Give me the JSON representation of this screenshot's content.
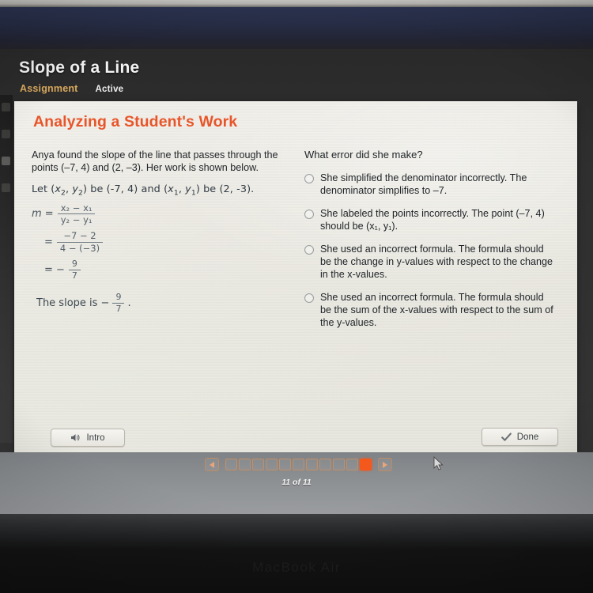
{
  "device": {
    "brand_label": "MacBook Air"
  },
  "header": {
    "lesson_title": "Slope of a Line",
    "assignment_label": "Assignment",
    "status_label": "Active"
  },
  "card": {
    "title": "Analyzing a Student's Work"
  },
  "work": {
    "prompt": "Anya found the slope of the line that passes through the points (–7, 4) and (2, –3). Her work is shown below.",
    "let_statement_parts": {
      "prefix": "Let (",
      "x2": "x",
      "x2sub": "2",
      "comma1": ", ",
      "y2": "y",
      "y2sub": "2",
      "mid": ") be (-7, 4) and (",
      "x1": "x",
      "x1sub": "1",
      "comma2": ", ",
      "y1": "y",
      "y1sub": "1",
      "suffix": ") be (2, -3)."
    },
    "equation_1": {
      "lhs": "m =",
      "numerator": "x₂ − x₁",
      "denominator": "y₂ − y₁"
    },
    "equation_2": {
      "lhs": "=",
      "numerator": "−7 − 2",
      "denominator": "4 − (−3)"
    },
    "equation_3": {
      "lhs": "= −",
      "numerator": "9",
      "denominator": "7"
    },
    "conclusion": {
      "text_before": "The slope is −",
      "numerator": "9",
      "denominator": "7",
      "text_after": "."
    }
  },
  "question": {
    "text": "What error did she make?",
    "choices": [
      {
        "id": "choice-a",
        "text": "She simplified the denominator incorrectly. The denominator simplifies to –7.",
        "selected": false
      },
      {
        "id": "choice-b",
        "text": "She labeled the points incorrectly. The point (–7, 4) should be (x₁, y₁).",
        "selected": false
      },
      {
        "id": "choice-c",
        "text": "She used an incorrect formula. The formula should be the change in y-values with respect to the change in the x-values.",
        "selected": false
      },
      {
        "id": "choice-d",
        "text": "She used an incorrect formula. The formula should be the sum of the x-values with respect to the sum of the y-values.",
        "selected": false
      }
    ]
  },
  "toolbar": {
    "intro_label": "Intro",
    "done_label": "Done"
  },
  "pager": {
    "total_pages": 11,
    "current_page": 11,
    "label": "11 of 11",
    "prev_label": "◀",
    "next_label": "▶"
  },
  "colors": {
    "accent_orange": "#e8552a",
    "pager_active": "#f4581c",
    "assignment_tan": "#d9a95e",
    "card_bg": "#ecebe4"
  }
}
